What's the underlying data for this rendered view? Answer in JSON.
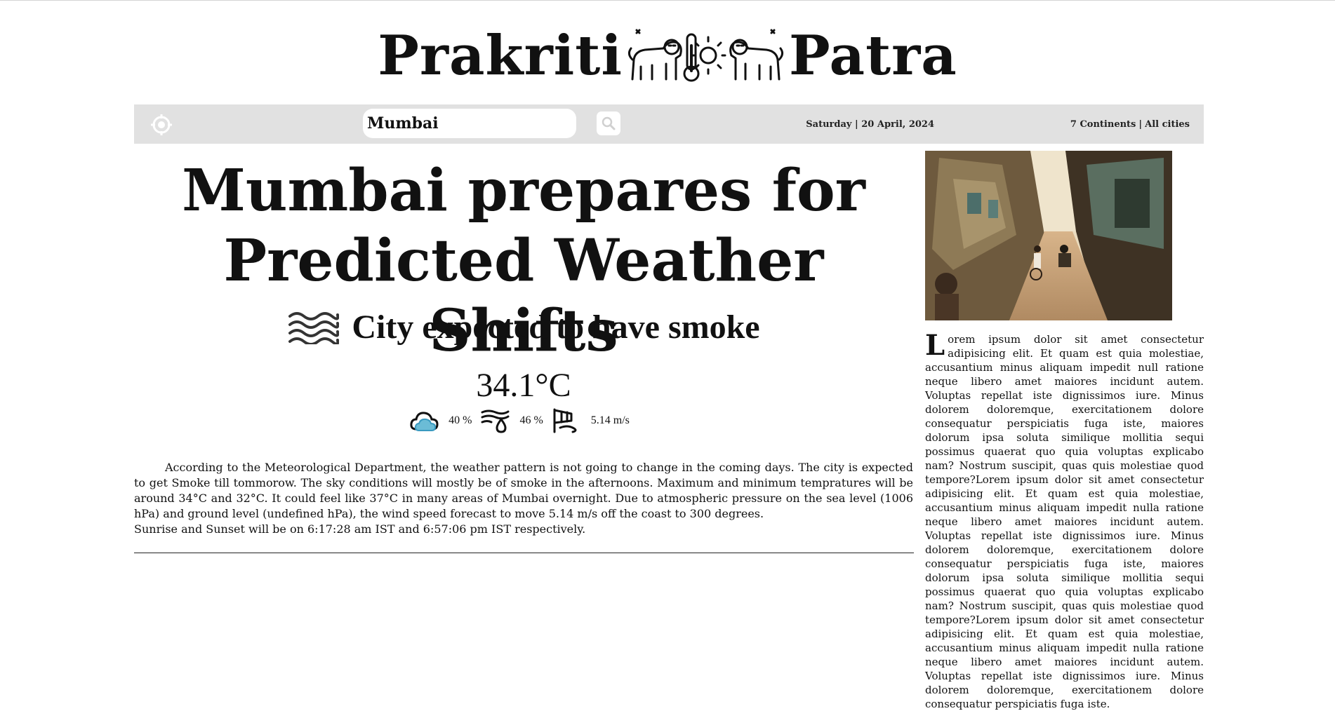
{
  "masthead": {
    "brand_left": "Prakriti",
    "brand_right": "Patra",
    "emblem_icon": "lion-thermometer-sun-emblem-icon"
  },
  "toolbar": {
    "locate_icon": "crosshair-location-icon",
    "search_value": "Mumbai",
    "search_icon": "search-icon",
    "date": "Saturday | 20 April, 2024",
    "continents": "7 Continents",
    "separator": "|",
    "all_cities": "All cities",
    "background": "#e1e1e1"
  },
  "article": {
    "headline": "Mumbai prepares for Predicted Weather Shifts",
    "subhead_icon": "smoke-haze-icon",
    "subhead": "City expected to have smoke",
    "temperature": "34.1°C",
    "stats": {
      "cloud_icon": "cloud-icon",
      "cloud": "40 %",
      "humidity_icon": "humidity-wind-drop-icon",
      "humidity": "46 %",
      "wind_icon": "wind-flag-icon",
      "wind": "5.14 m/s"
    },
    "body_paragraph": "According to the Meteorological Department, the weather pattern is not going to change in the coming days. The city is expected to get Smoke till tommorow. The sky conditions will mostly be of smoke in the afternoons. Maximum and minimum tempratures will be around 34°C and 32°C. It could feel like 37°C in many areas of Mumbai overnight. Due to atmospheric pressure on the sea level (1006 hPa) and ground level (undefined hPa), the wind speed forecast to move 5.14 m/s off the coast to 300 degrees.",
    "body_sun": "Sunrise and Sunset will be on 6:17:28 am IST and 6:57:06 pm IST respectively."
  },
  "sidebar": {
    "photo": "street-scene-photo",
    "dropcap": "L",
    "text": "orem ipsum dolor sit amet consectetur adipisicing elit. Et quam est quia molestiae, accusantium minus aliquam impedit null ratione neque libero amet maiores incidunt autem. Voluptas repellat iste dignissimos iure. Minus dolorem doloremque, exercitationem dolore consequatur perspiciatis fuga iste, maiores dolorum ipsa soluta similique mollitia sequi possimus quaerat quo quia voluptas explicabo nam? Nostrum suscipit, quas quis molestiae quod tempore?Lorem ipsum dolor sit amet consectetur adipisicing elit. Et quam est quia molestiae, accusantium minus aliquam impedit nulla ratione neque libero amet maiores incidunt autem. Voluptas repellat iste dignissimos iure. Minus dolorem doloremque, exercitationem dolore consequatur perspiciatis fuga iste, maiores dolorum ipsa soluta similique mollitia sequi possimus quaerat quo quia voluptas explicabo nam? Nostrum suscipit, quas quis molestiae quod tempore?Lorem ipsum dolor sit amet consectetur adipisicing elit. Et quam est quia molestiae, accusantium minus aliquam impedit nulla ratione neque libero amet maiores incidunt autem. Voluptas repellat iste dignissimos iure. Minus dolorem doloremque, exercitationem dolore consequatur perspiciatis fuga iste."
  }
}
